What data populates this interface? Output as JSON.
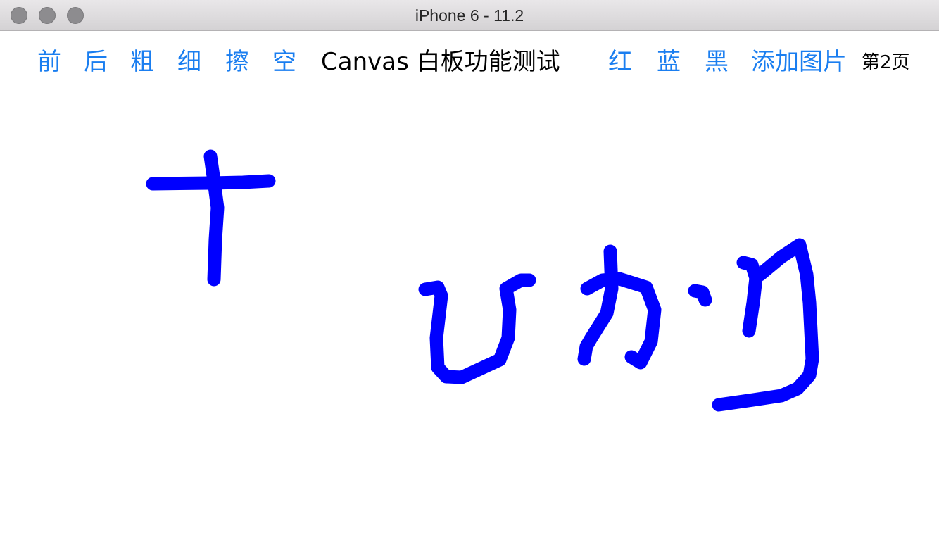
{
  "window": {
    "title": "iPhone 6 - 11.2"
  },
  "toolbar": {
    "left_buttons": [
      "前",
      "后",
      "粗",
      "细",
      "擦",
      "空"
    ],
    "title": "Canvas 白板功能测试",
    "right_buttons": [
      "红",
      "蓝",
      "黑"
    ],
    "add_image": "添加图片",
    "page": "第2页"
  },
  "canvas": {
    "background": "#ffffff",
    "stroke_color": "#0000ff",
    "link_color": "#1a7ef0"
  }
}
